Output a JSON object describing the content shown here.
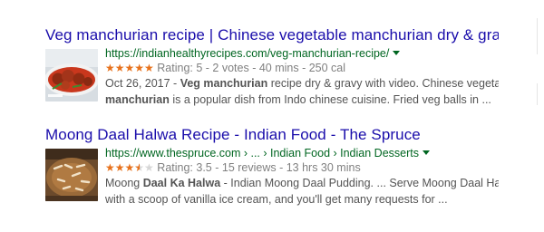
{
  "results": [
    {
      "title": "Veg manchurian recipe | Chinese vegetable manchurian dry & gravy ...",
      "url": "https://indianhealthyrecipes.com/veg-manchurian-recipe/",
      "rating_value": 5,
      "rating_text": "Rating: 5 - 2 votes - 40 mins - 250 cal",
      "snippet_line1_pre": "Oct 26, 2017 - ",
      "snippet_line1_bold": "Veg manchurian",
      "snippet_line1_post": " recipe dry & gravy with video. Chinese vegetable",
      "snippet_line2_bold": "manchurian",
      "snippet_line2_post": " is a popular dish from Indo chinese cuisine. Fried veg balls in ...",
      "thumbnail_icon": "veg-manchurian-photo"
    },
    {
      "title": "Moong Daal Halwa Recipe - Indian Food - The Spruce",
      "url": "https://www.thespruce.com › ... › Indian Food › Indian Desserts",
      "rating_value": 3.5,
      "rating_text": "Rating: 3.5 - 15 reviews - 13 hrs 30 mins",
      "snippet_line1_pre": "Moong ",
      "snippet_line1_bold": "Daal Ka Halwa",
      "snippet_line1_post": " - Indian Moong Daal Pudding. ... Serve Moong Daal Halwa warm",
      "snippet_line2_bold": "",
      "snippet_line2_post": "with a scoop of vanilla ice cream, and you'll get many requests for ...",
      "thumbnail_icon": "moong-daal-halwa-photo"
    }
  ],
  "colors": {
    "title": "#1a0dab",
    "url": "#006621",
    "star": "#e7711b",
    "snippet": "#545454"
  }
}
